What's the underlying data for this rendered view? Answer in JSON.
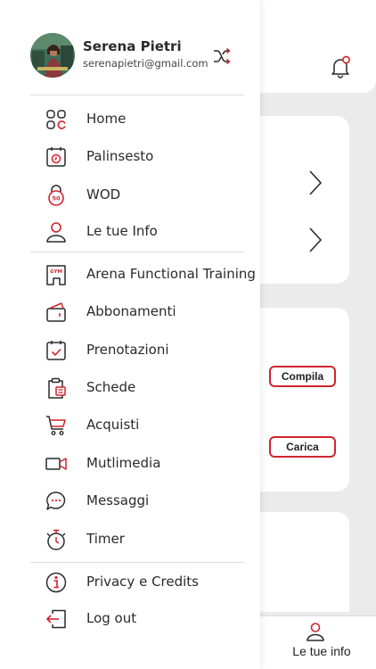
{
  "colors": {
    "accent": "#d0242c",
    "ink": "#2a2a2a",
    "background": "#ebebeb"
  },
  "user": {
    "name": "Serena Pietri",
    "email": "serenapietri@gmail.com",
    "switch_icon": "shuffle-icon"
  },
  "menu": {
    "group1": [
      {
        "label": "Home",
        "icon": "grid-icon"
      },
      {
        "label": "Palinsesto",
        "icon": "calendar-clock-icon"
      },
      {
        "label": "WOD",
        "icon": "kettlebell-icon"
      },
      {
        "label": "Le tue Info",
        "icon": "user-icon"
      }
    ],
    "group2": [
      {
        "label": "Arena Functional Training",
        "icon": "gym-icon"
      },
      {
        "label": "Abbonamenti",
        "icon": "wallet-icon"
      },
      {
        "label": "Prenotazioni",
        "icon": "calendar-check-icon"
      },
      {
        "label": "Schede",
        "icon": "clipboard-icon"
      },
      {
        "label": "Acquisti",
        "icon": "cart-icon"
      },
      {
        "label": "Mutlimedia",
        "icon": "video-icon"
      },
      {
        "label": "Messaggi",
        "icon": "chat-icon"
      },
      {
        "label": "Timer",
        "icon": "stopwatch-icon"
      }
    ],
    "group3": [
      {
        "label": "Privacy e Credits",
        "icon": "info-icon"
      },
      {
        "label": "Log out",
        "icon": "logout-icon"
      }
    ]
  },
  "background_screen": {
    "compila_label": "Compila",
    "carica_label": "Carica",
    "bottom_tab_label": "Le tue info"
  }
}
